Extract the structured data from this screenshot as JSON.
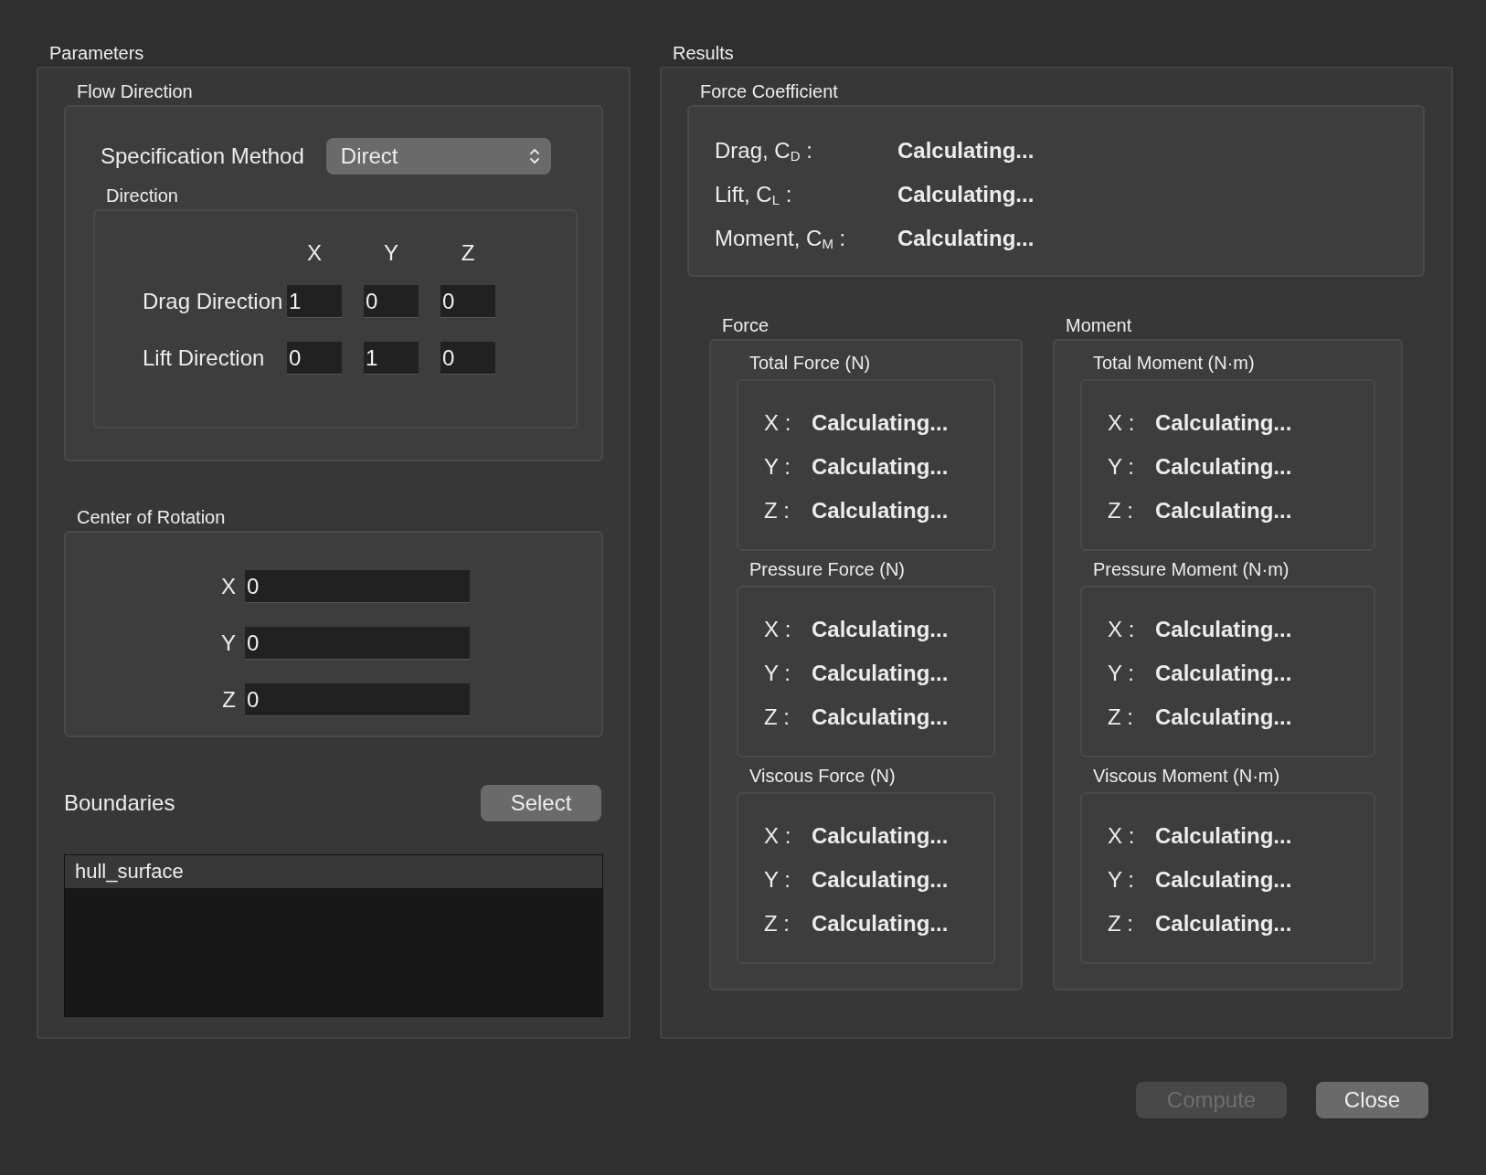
{
  "parameters": {
    "title": "Parameters",
    "flow_direction": {
      "title": "Flow Direction",
      "specification_method": {
        "label": "Specification Method",
        "value": "Direct"
      },
      "direction": {
        "title": "Direction",
        "columns": [
          "X",
          "Y",
          "Z"
        ],
        "rows": [
          {
            "label": "Drag Direction",
            "values": [
              "1",
              "0",
              "0"
            ]
          },
          {
            "label": "Lift Direction",
            "values": [
              "0",
              "1",
              "0"
            ]
          }
        ]
      }
    },
    "center_of_rotation": {
      "title": "Center of Rotation",
      "fields": [
        {
          "label": "X",
          "value": "0"
        },
        {
          "label": "Y",
          "value": "0"
        },
        {
          "label": "Z",
          "value": "0"
        }
      ]
    },
    "boundaries": {
      "title": "Boundaries",
      "select_button": "Select",
      "items": [
        {
          "name": "hull_surface",
          "selected": true
        }
      ]
    }
  },
  "results": {
    "title": "Results",
    "force_coefficient": {
      "title": "Force Coefficient",
      "rows": [
        {
          "label": "Drag, C$_{D}$ :",
          "value": "Calculating..."
        },
        {
          "label": "Lift, C$_{L}$ :",
          "value": "Calculating..."
        },
        {
          "label": "Moment, C$_{M}$ :",
          "value": "Calculating..."
        }
      ]
    },
    "groups": [
      {
        "title": "Force",
        "sections": [
          {
            "title": "Total Force (N)",
            "rows": [
              {
                "label": "X :",
                "value": "Calculating..."
              },
              {
                "label": "Y :",
                "value": "Calculating..."
              },
              {
                "label": "Z :",
                "value": "Calculating..."
              }
            ]
          },
          {
            "title": "Pressure Force (N)",
            "rows": [
              {
                "label": "X :",
                "value": "Calculating..."
              },
              {
                "label": "Y :",
                "value": "Calculating..."
              },
              {
                "label": "Z :",
                "value": "Calculating..."
              }
            ]
          },
          {
            "title": "Viscous Force (N)",
            "rows": [
              {
                "label": "X :",
                "value": "Calculating..."
              },
              {
                "label": "Y :",
                "value": "Calculating..."
              },
              {
                "label": "Z :",
                "value": "Calculating..."
              }
            ]
          }
        ]
      },
      {
        "title": "Moment",
        "sections": [
          {
            "title": "Total Moment (N·m)",
            "rows": [
              {
                "label": "X :",
                "value": "Calculating..."
              },
              {
                "label": "Y :",
                "value": "Calculating..."
              },
              {
                "label": "Z :",
                "value": "Calculating..."
              }
            ]
          },
          {
            "title": "Pressure Moment (N·m)",
            "rows": [
              {
                "label": "X :",
                "value": "Calculating..."
              },
              {
                "label": "Y :",
                "value": "Calculating..."
              },
              {
                "label": "Z :",
                "value": "Calculating..."
              }
            ]
          },
          {
            "title": "Viscous Moment (N·m)",
            "rows": [
              {
                "label": "X :",
                "value": "Calculating..."
              },
              {
                "label": "Y :",
                "value": "Calculating..."
              },
              {
                "label": "Z :",
                "value": "Calculating..."
              }
            ]
          }
        ]
      }
    ]
  },
  "buttons": [
    {
      "label": "Compute",
      "disabled": true
    },
    {
      "label": "Close",
      "disabled": false
    }
  ]
}
